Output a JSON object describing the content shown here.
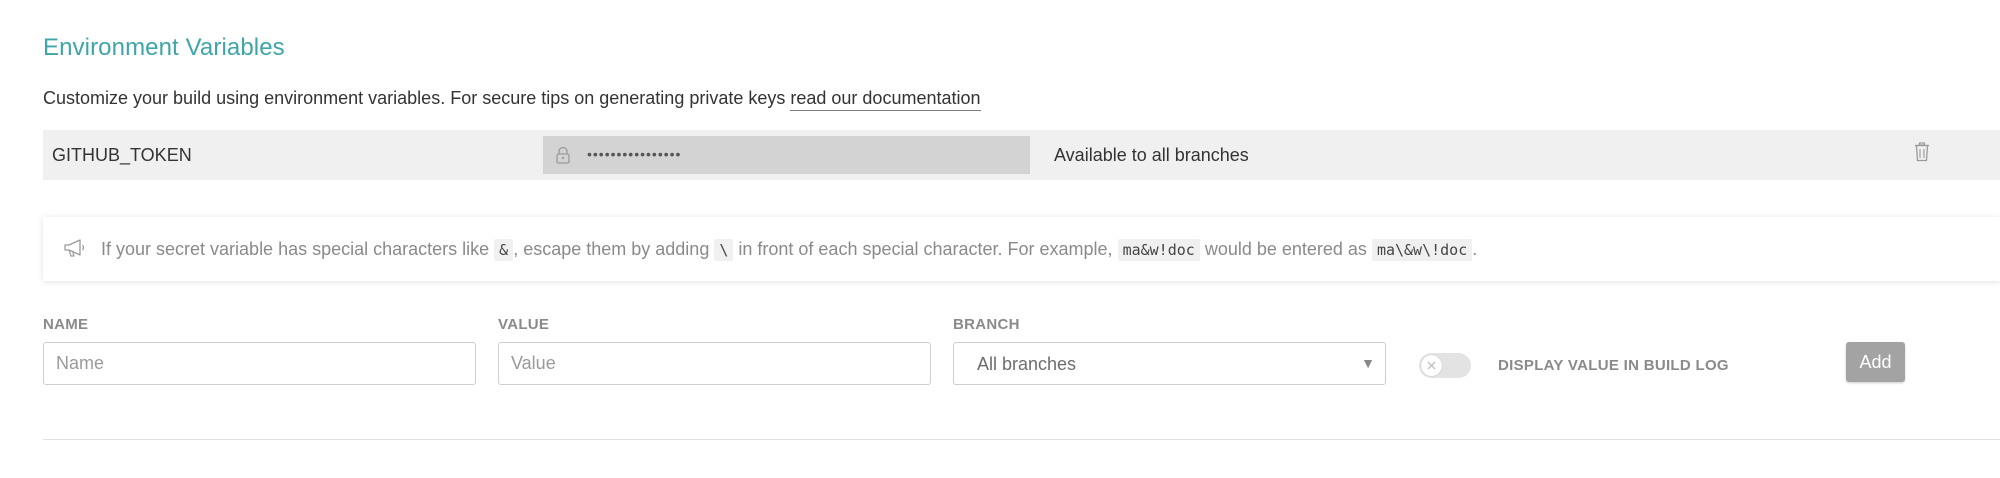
{
  "section": {
    "title": "Environment Variables",
    "description_prefix": "Customize your build using environment variables. For secure tips on generating private keys ",
    "description_link": "read our documentation"
  },
  "env_vars": [
    {
      "name": "GITHUB_TOKEN",
      "masked_value": "••••••••••••••••",
      "branch": "Available to all branches",
      "lock_icon": "lock-icon",
      "delete_icon": "trash-icon"
    }
  ],
  "notice": {
    "icon": "megaphone-icon",
    "text_1": "If your secret variable has special characters like ",
    "code_1": "&",
    "text_2": ", escape them by adding ",
    "code_2": "\\",
    "text_3": " in front of each special character. For example, ",
    "code_3": "ma&w!doc",
    "text_4": " would be entered as ",
    "code_4": "ma\\&w\\!doc",
    "text_5": "."
  },
  "form": {
    "name_label": "NAME",
    "name_placeholder": "Name",
    "value_label": "VALUE",
    "value_placeholder": "Value",
    "branch_label": "BRANCH",
    "branch_selected": "All branches",
    "toggle_label": "DISPLAY VALUE IN BUILD LOG",
    "toggle_on": false,
    "add_label": "Add"
  },
  "colors": {
    "title": "#3fa5a8",
    "row_bg": "#f0f0f0",
    "masked_bg": "#d3d3d3",
    "add_button": "#a3a3a3"
  }
}
